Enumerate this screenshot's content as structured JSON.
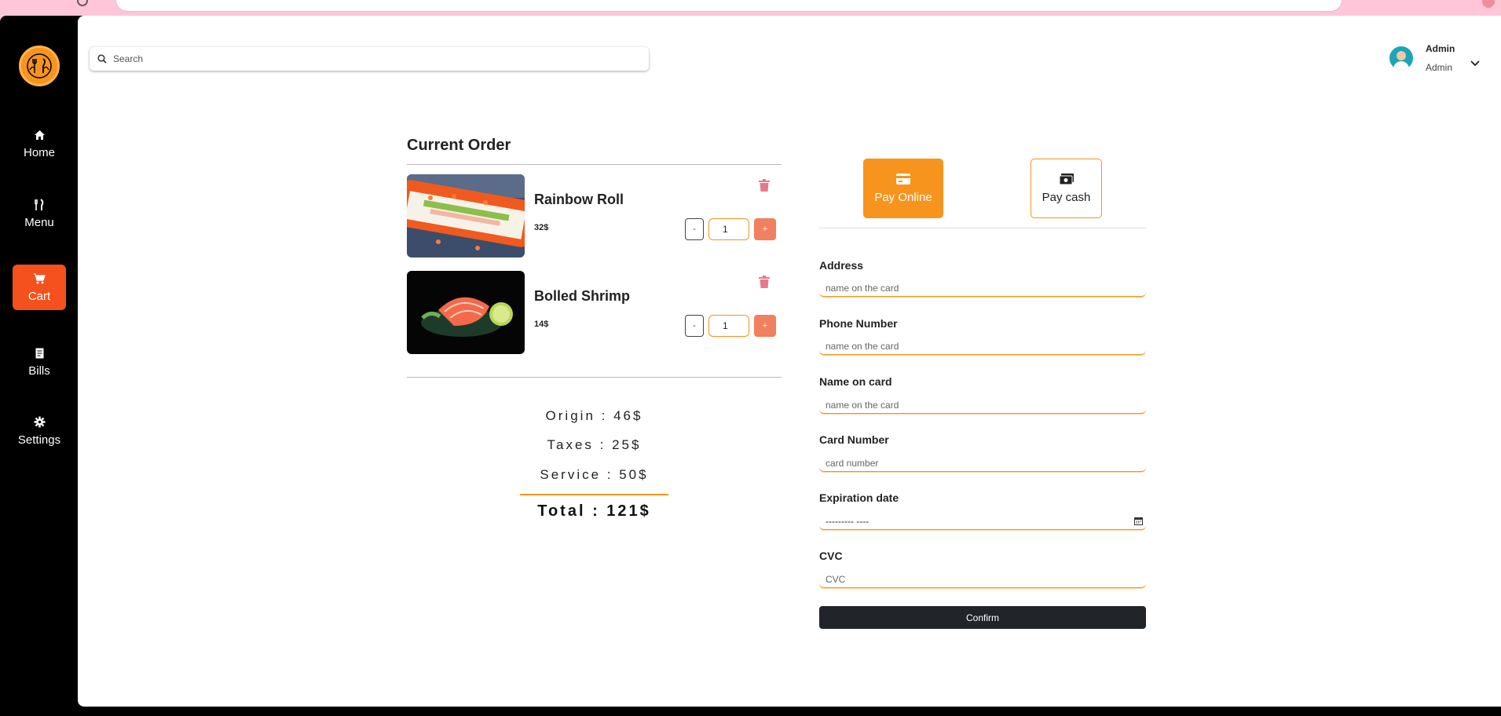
{
  "search": {
    "placeholder": "Search"
  },
  "user": {
    "name": "Admin",
    "role": "Admin"
  },
  "sidebar": {
    "items": [
      {
        "label": "Home",
        "icon": "home-icon"
      },
      {
        "label": "Menu",
        "icon": "utensils-icon"
      },
      {
        "label": "Cart",
        "icon": "cart-icon",
        "active": true
      },
      {
        "label": "Bills",
        "icon": "receipt-icon"
      },
      {
        "label": "Settings",
        "icon": "gear-icon"
      }
    ]
  },
  "order": {
    "title": "Current Order",
    "items": [
      {
        "name": "Rainbow Roll",
        "price": "32$",
        "qty": "1",
        "minus": "-",
        "plus": "+"
      },
      {
        "name": "Bolled Shrimp",
        "price": "14$",
        "qty": "1",
        "minus": "-",
        "plus": "+"
      }
    ],
    "summary": {
      "origin": "Origin : 46$",
      "taxes": "Taxes : 25$",
      "service": "Service : 50$",
      "total": "Total : 121$"
    }
  },
  "payment": {
    "online_label": "Pay Online",
    "cash_label": "Pay cash",
    "fields": [
      {
        "label": "Address",
        "value": "name on the card"
      },
      {
        "label": "Phone Number",
        "value": "name on the card"
      },
      {
        "label": "Name on card",
        "value": "name on the card"
      },
      {
        "label": "Card Number",
        "value": "card number"
      },
      {
        "label": "Expiration date",
        "value": "--------- ----"
      },
      {
        "label": "CVC",
        "value": "CVC"
      }
    ],
    "confirm_label": "Confirm"
  },
  "colors": {
    "accent": "#f7941d",
    "active": "#f4511e",
    "plus": "#f0805e",
    "trash": "#e8788b",
    "confirm": "#212529"
  }
}
